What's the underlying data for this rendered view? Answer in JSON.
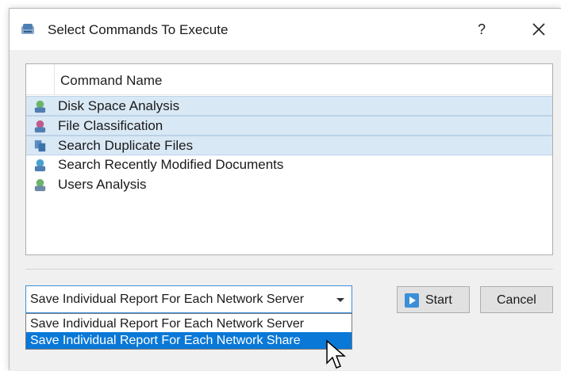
{
  "dialog": {
    "title": "Select Commands To Execute",
    "help_label": "?"
  },
  "list": {
    "column_header": "Command Name",
    "items": [
      {
        "label": "Disk Space Analysis",
        "icon": "disk-analysis-icon",
        "selected": true
      },
      {
        "label": "File Classification",
        "icon": "file-classification-icon",
        "selected": true
      },
      {
        "label": "Search Duplicate Files",
        "icon": "duplicate-files-icon",
        "selected": true
      },
      {
        "label": "Search Recently Modified Documents",
        "icon": "modified-documents-icon",
        "selected": false
      },
      {
        "label": "Users Analysis",
        "icon": "users-analysis-icon",
        "selected": false
      }
    ]
  },
  "report_mode": {
    "selected": "Save Individual Report For Each Network Server",
    "options": [
      "Save Individual Report For Each Network Server",
      "Save Individual Report For Each Network Share"
    ],
    "highlighted_index": 1
  },
  "buttons": {
    "start": "Start",
    "cancel": "Cancel"
  },
  "colors": {
    "selection_bg": "#d9e8f5",
    "highlight": "#0a78d7",
    "accent_border": "#3c8fdb"
  }
}
